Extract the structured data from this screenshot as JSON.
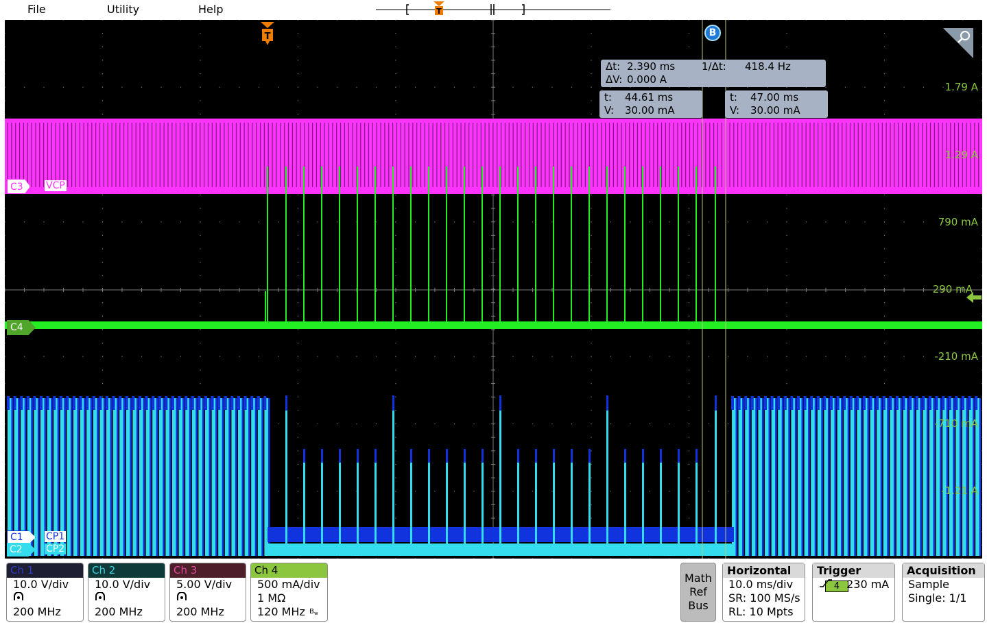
{
  "menu": {
    "file": "File",
    "utility": "Utility",
    "help": "Help"
  },
  "trigger_marker": "T",
  "cursor_b_label": "B",
  "channels": {
    "c3": {
      "label": "C3",
      "name": "VCP",
      "color": "#ff33ff"
    },
    "c4": {
      "label": "C4",
      "color": "#22ee22"
    },
    "c1": {
      "label": "C1",
      "name": "CP1",
      "color": "#1133dd"
    },
    "c2": {
      "label": "C2",
      "name": "CP2",
      "color": "#33ddee"
    }
  },
  "scale_labels": [
    "1.79  A",
    "1.29  A",
    "790 mA",
    "290 mA",
    "-210 mA",
    "-710 mA",
    "-1.21 A"
  ],
  "readouts": {
    "delta": {
      "dt_label": "Δt:",
      "dt_value": "2.390 ms",
      "inv_label": "1/Δt:",
      "inv_value": "418.4 Hz",
      "dv_label": "ΔV:",
      "dv_value": "0.000  A"
    },
    "cursor_a": {
      "t_label": "t:",
      "t_value": "44.61 ms",
      "v_label": "V:",
      "v_value": "30.00 mA"
    },
    "cursor_b": {
      "t_label": "t:",
      "t_value": "47.00 ms",
      "v_label": "V:",
      "v_value": "30.00 mA"
    }
  },
  "channel_boxes": [
    {
      "title": "Ch 1",
      "scale": "10.0 V/div",
      "bw": "200 MHz",
      "header_bg": "#1f1f33",
      "header_fg": "#2e3bc4"
    },
    {
      "title": "Ch 2",
      "scale": "10.0 V/div",
      "bw": "200 MHz",
      "header_bg": "#0e3a3a",
      "header_fg": "#3ad2e0"
    },
    {
      "title": "Ch 3",
      "scale": "5.00 V/div",
      "bw": "200 MHz",
      "header_bg": "#4d1f2b",
      "header_fg": "#e0499a"
    },
    {
      "title": "Ch 4",
      "scale": "500 mA/div",
      "impedance": "1 MΩ",
      "bw": "120 MHz",
      "header_bg": "#8cc63f",
      "header_fg": "#000000"
    }
  ],
  "math_ref_bus": {
    "math": "Math",
    "ref": "Ref",
    "bus": "Bus"
  },
  "horizontal": {
    "title": "Horizontal",
    "scale": "10.0 ms/div",
    "sr": "SR: 100 MS/s",
    "rl": "RL: 10 Mpts"
  },
  "trigger": {
    "title": "Trigger",
    "source": "4",
    "level": "230 mA"
  },
  "acquisition": {
    "title": "Acquisition",
    "mode": "Sample",
    "state": "Single: 1/1"
  }
}
